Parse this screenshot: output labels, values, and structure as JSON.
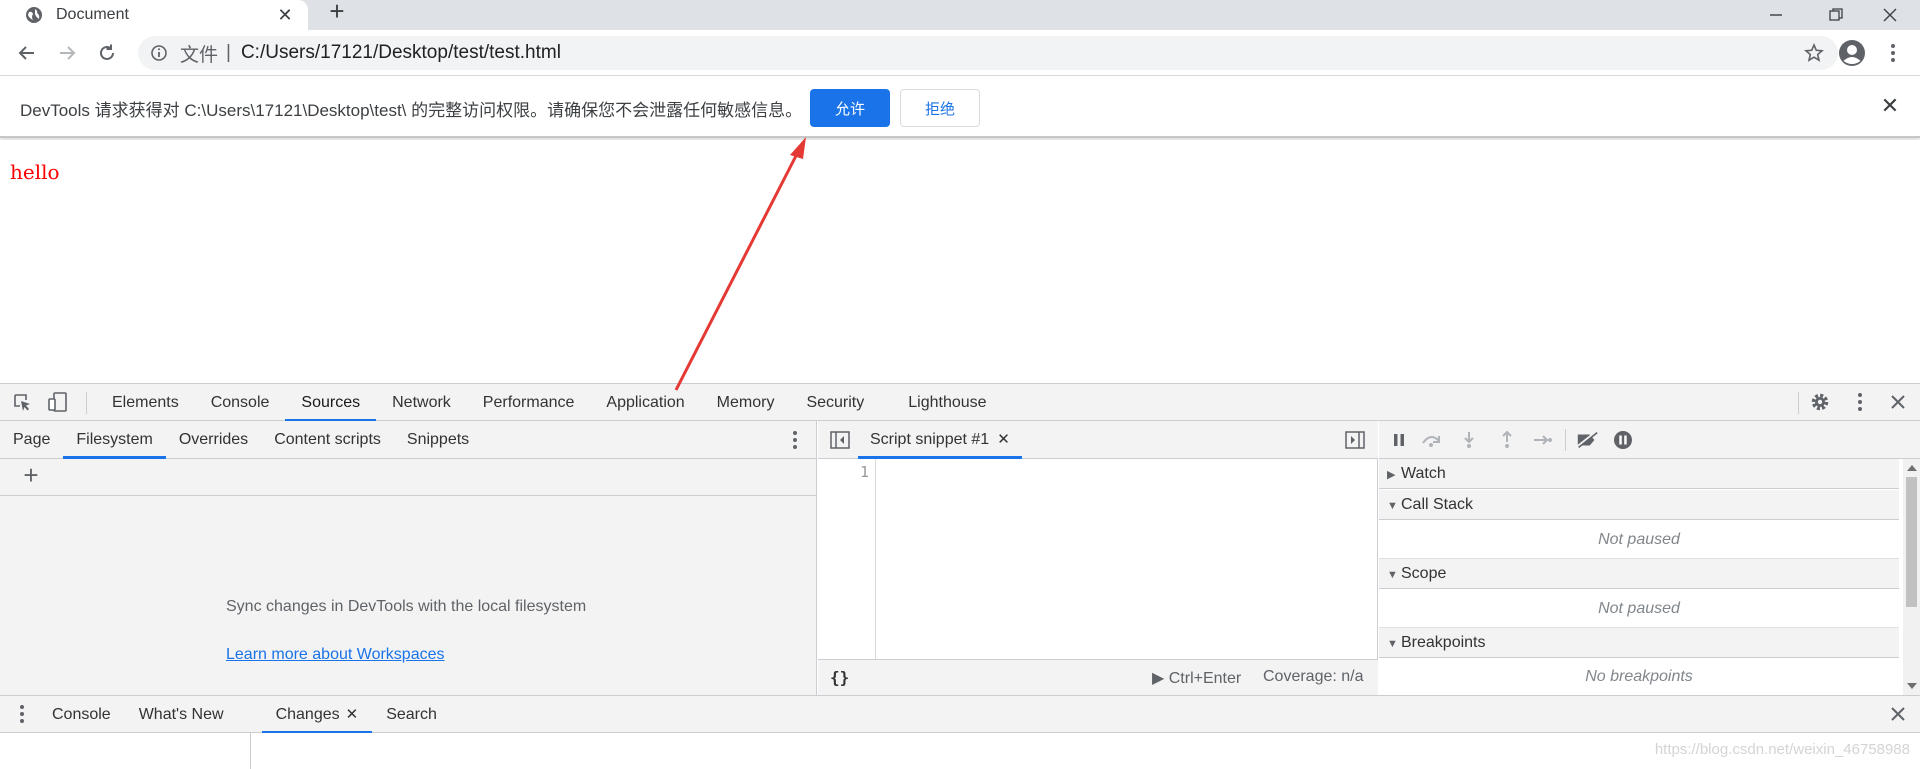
{
  "browser": {
    "tab_title": "Document",
    "tab_close": "✕",
    "new_tab": "+",
    "address": {
      "scheme_label": "文件",
      "separator": "|",
      "url": "C:/Users/17121/Desktop/test/test.html"
    }
  },
  "infobar": {
    "message": "DevTools 请求获得对 C:\\Users\\17121\\Desktop\\test\\ 的完整访问权限。请确保您不会泄露任何敏感信息。",
    "allow_label": "允许",
    "deny_label": "拒绝",
    "close": "✕"
  },
  "page": {
    "text": "hello",
    "text_color": "#ff0000"
  },
  "devtools": {
    "main_tabs": [
      "Elements",
      "Console",
      "Sources",
      "Network",
      "Performance",
      "Application",
      "Memory",
      "Security",
      "Lighthouse"
    ],
    "active_main_tab": "Sources",
    "navigator": {
      "tabs": [
        "Page",
        "Filesystem",
        "Overrides",
        "Content scripts",
        "Snippets"
      ],
      "active_tab": "Filesystem",
      "add_folder": "+",
      "sync_text": "Sync changes in DevTools with the local filesystem",
      "learn_link": "Learn more about Workspaces"
    },
    "editor": {
      "tab_label": "Script snippet #1",
      "tab_close": "✕",
      "line_number": "1",
      "pretty_print": "{}",
      "run_label": "▶ Ctrl+Enter",
      "coverage": "Coverage: n/a"
    },
    "debugger": {
      "watch": "Watch",
      "call_stack": "Call Stack",
      "call_stack_msg": "Not paused",
      "scope": "Scope",
      "scope_msg": "Not paused",
      "breakpoints": "Breakpoints",
      "breakpoints_msg": "No breakpoints"
    },
    "drawer": {
      "tabs": [
        "Console",
        "What's New",
        "Changes",
        "Search"
      ],
      "active_tab": "Changes",
      "changes_close": "✕",
      "watermark": "https://blog.csdn.net/weixin_46758988"
    }
  },
  "colors": {
    "accent": "#1a73e8",
    "annotation_arrow": "#e53935"
  }
}
